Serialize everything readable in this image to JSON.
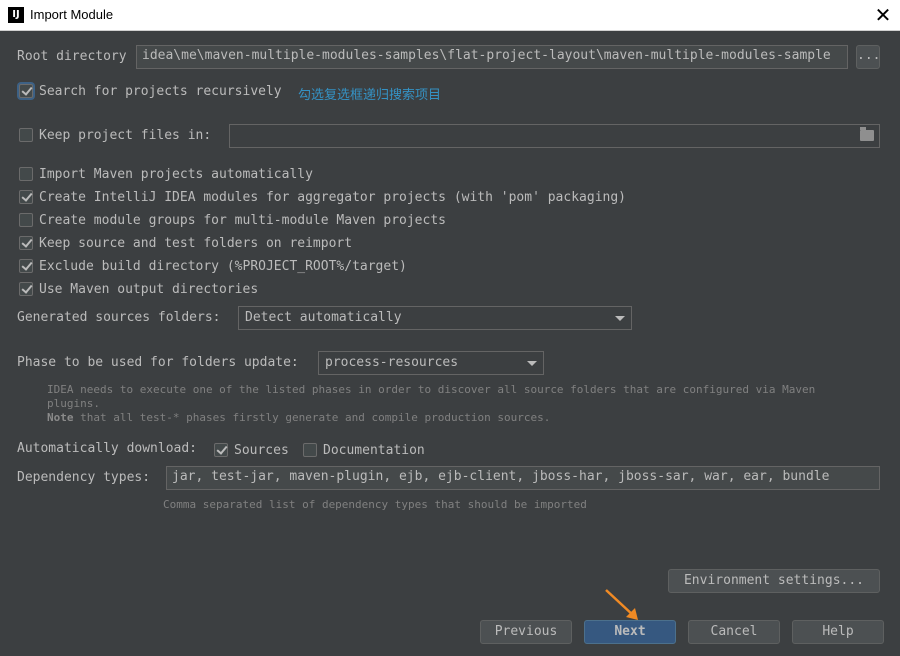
{
  "window": {
    "title": "Import Module",
    "app_icon_text": "IJ",
    "close_glyph": "✕"
  },
  "root_directory": {
    "label": "Root directory",
    "value": "idea\\me\\maven-multiple-modules-samples\\flat-project-layout\\maven-multiple-modules-sample",
    "browse_label": "..."
  },
  "search_recursively": {
    "label": "Search for projects recursively",
    "checked": true,
    "annotation": "勾选复选框递归搜索项目"
  },
  "keep_project_files": {
    "label": "Keep project files in:",
    "checked": false,
    "value": ""
  },
  "options": [
    {
      "label": "Import Maven projects automatically",
      "checked": false
    },
    {
      "label": "Create IntelliJ IDEA modules for aggregator projects (with 'pom' packaging)",
      "checked": true
    },
    {
      "label": "Create module groups for multi-module Maven projects",
      "checked": false
    },
    {
      "label": "Keep source and test folders on reimport",
      "checked": true
    },
    {
      "label": "Exclude build directory (%PROJECT_ROOT%/target)",
      "checked": true
    },
    {
      "label": "Use Maven output directories",
      "checked": true
    }
  ],
  "generated_sources": {
    "label": "Generated sources folders:",
    "value": "Detect automatically"
  },
  "phase": {
    "label": "Phase to be used for folders update:",
    "value": "process-resources",
    "hint_line1": "IDEA needs to execute one of the listed phases in order to discover all source folders that are configured via Maven",
    "hint_line2": "plugins.",
    "hint_note_bold": "Note",
    "hint_note_rest": " that all test-* phases firstly generate and compile production sources."
  },
  "auto_download": {
    "label": "Automatically download:",
    "sources_label": "Sources",
    "sources_checked": true,
    "docs_label": "Documentation",
    "docs_checked": false
  },
  "dependency_types": {
    "label": "Dependency types:",
    "value": "jar, test-jar, maven-plugin, ejb, ejb-client, jboss-har, jboss-sar, war, ear, bundle",
    "hint": "Comma separated list of dependency types that should be imported"
  },
  "buttons": {
    "environment": "Environment settings...",
    "previous": "Previous",
    "next": "Next",
    "cancel": "Cancel",
    "help": "Help"
  },
  "colors": {
    "background": "#3c3f41",
    "default_button": "#365880",
    "annotation_arrow": "#f08a24",
    "annotation_text": "#3592c4"
  }
}
